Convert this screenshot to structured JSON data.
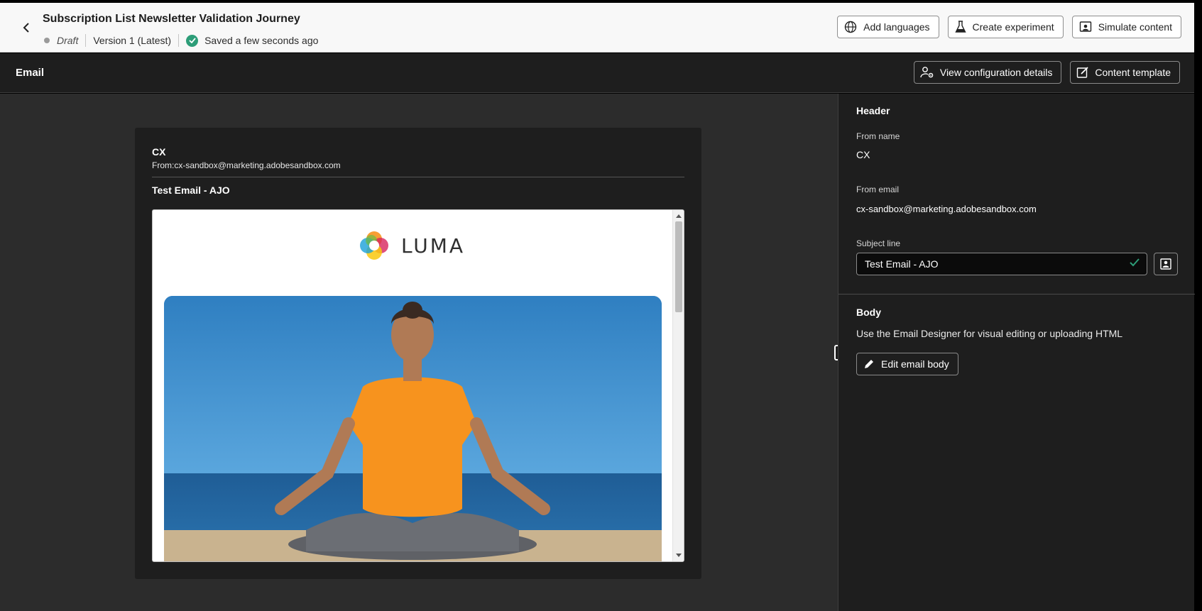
{
  "header": {
    "title": "Subscription List Newsletter Validation Journey",
    "status": "Draft",
    "version": "Version 1 (Latest)",
    "saved": "Saved a few seconds ago",
    "actions": {
      "add_languages": "Add languages",
      "create_experiment": "Create experiment",
      "simulate_content": "Simulate content"
    }
  },
  "email_bar": {
    "title": "Email",
    "view_config": "View configuration details",
    "content_template": "Content template"
  },
  "preview": {
    "from_name": "CX",
    "from_line": "From:cx-sandbox@marketing.adobesandbox.com",
    "subject": "Test Email - AJO",
    "brand": "LUMA"
  },
  "panel": {
    "header_title": "Header",
    "from_name_label": "From name",
    "from_name": "CX",
    "from_email_label": "From email",
    "from_email": "cx-sandbox@marketing.adobesandbox.com",
    "subject_label": "Subject line",
    "subject_value": "Test Email - AJO",
    "body_title": "Body",
    "body_desc": "Use the Email Designer for visual editing or uploading HTML",
    "edit_body": "Edit email body"
  },
  "colors": {
    "success": "#2d9d78",
    "dark_bg": "#1e1e1e",
    "canvas_bg": "#2c2c2c"
  },
  "icons": [
    "chevron-left-icon",
    "checkmark-circle-icon",
    "globe-icon",
    "beaker-icon",
    "simulate-icon",
    "config-user-gear-icon",
    "edit-template-icon",
    "checkmark-icon",
    "personalize-icon",
    "pencil-icon"
  ]
}
